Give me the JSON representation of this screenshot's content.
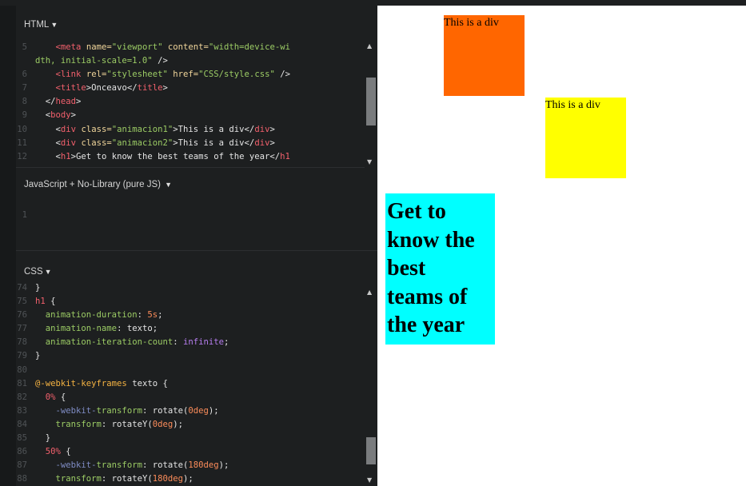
{
  "panels": {
    "html_title": "HTML",
    "js_title": "JavaScript + No-Library (pure JS)",
    "css_title": "CSS",
    "caret": "▼"
  },
  "scroll_arrows": {
    "up": "▲",
    "down": "▼"
  },
  "html_code": {
    "line5": {
      "num": "5",
      "indent": "    ",
      "open": "<",
      "tag": "meta",
      "attr1": "name=",
      "val1": "\"viewport\"",
      "attr2": "content=",
      "val2": "\"width=device-wi"
    },
    "line5b": {
      "indent": "dth, initial-scale=1.0\"",
      "close": " />"
    },
    "line6": {
      "num": "6",
      "indent": "    ",
      "open": "<",
      "tag": "link",
      "attr1": "rel=",
      "val1": "\"stylesheet\"",
      "attr2": "href=",
      "val2": "\"CSS/style.css\"",
      "close": " />"
    },
    "line7": {
      "num": "7",
      "indent": "    ",
      "open": "<",
      "tag": "title",
      "mid": ">Onceavo</",
      "tag2": "title",
      "close": ">"
    },
    "line8": {
      "num": "8",
      "indent": "  ",
      "open": "</",
      "tag": "head",
      "close": ">"
    },
    "line9": {
      "num": "9",
      "indent": "  ",
      "open": "<",
      "tag": "body",
      "close": ">"
    },
    "line10": {
      "num": "10",
      "indent": "    ",
      "open": "<",
      "tag": "div",
      "attr1": "class=",
      "val1": "\"animacion1\"",
      "mid": ">This is a div</",
      "tag2": "div",
      "close": ">"
    },
    "line11": {
      "num": "11",
      "indent": "    ",
      "open": "<",
      "tag": "div",
      "attr1": "class=",
      "val1": "\"animacion2\"",
      "mid": ">This is a div</",
      "tag2": "div",
      "close": ">"
    },
    "line12": {
      "num": "12",
      "indent": "    ",
      "open": "<",
      "tag": "h1",
      "mid": ">Get to know the best teams of the year</",
      "tag2": "h1"
    }
  },
  "js_code": {
    "line1": {
      "num": "1"
    }
  },
  "css_code": {
    "l74": {
      "num": "74",
      "text": "}"
    },
    "l75": {
      "num": "75",
      "sel": "h1",
      "text": " {"
    },
    "l76": {
      "num": "76",
      "indent": "  ",
      "prop": "animation-duration",
      "colon": ": ",
      "val": "5s",
      "end": ";"
    },
    "l77": {
      "num": "77",
      "indent": "  ",
      "prop": "animation-name",
      "colon": ": ",
      "val": "texto",
      "end": ";"
    },
    "l78": {
      "num": "78",
      "indent": "  ",
      "prop": "animation-iteration-count",
      "colon": ": ",
      "val": "infinite",
      "end": ";"
    },
    "l79": {
      "num": "79",
      "text": "}"
    },
    "l80": {
      "num": "80"
    },
    "l81": {
      "num": "81",
      "at": "@-webkit-keyframes",
      "text": " texto {"
    },
    "l82": {
      "num": "82",
      "indent": "  ",
      "sel": "0%",
      "text": " {"
    },
    "l83": {
      "num": "83",
      "indent": "    ",
      "pref": "-webkit-",
      "prop": "transform",
      "colon": ": rotate(",
      "val": "0deg",
      "end": ");"
    },
    "l84": {
      "num": "84",
      "indent": "    ",
      "prop": "transform",
      "colon": ": rotateY(",
      "val": "0deg",
      "end": ");"
    },
    "l85": {
      "num": "85",
      "indent": "  ",
      "text": "}"
    },
    "l86": {
      "num": "86",
      "indent": "  ",
      "sel": "50%",
      "text": " {"
    },
    "l87": {
      "num": "87",
      "indent": "    ",
      "pref": "-webkit-",
      "prop": "transform",
      "colon": ": rotate(",
      "val": "180deg",
      "end": ");"
    },
    "l88": {
      "num": "88",
      "indent": "    ",
      "prop": "transform",
      "colon": ": rotateY(",
      "val": "180deg",
      "end": ");"
    }
  },
  "result": {
    "div1_text": "This is a div",
    "div2_text": "This is a div",
    "heading_lines": [
      "Get to",
      "know the",
      "best",
      "teams of",
      "the year"
    ]
  },
  "colors": {
    "div1_bg": "#ff6600",
    "div2_bg": "#ffff00",
    "heading_bg": "#00ffff",
    "editor_bg": "#1d1f20"
  }
}
